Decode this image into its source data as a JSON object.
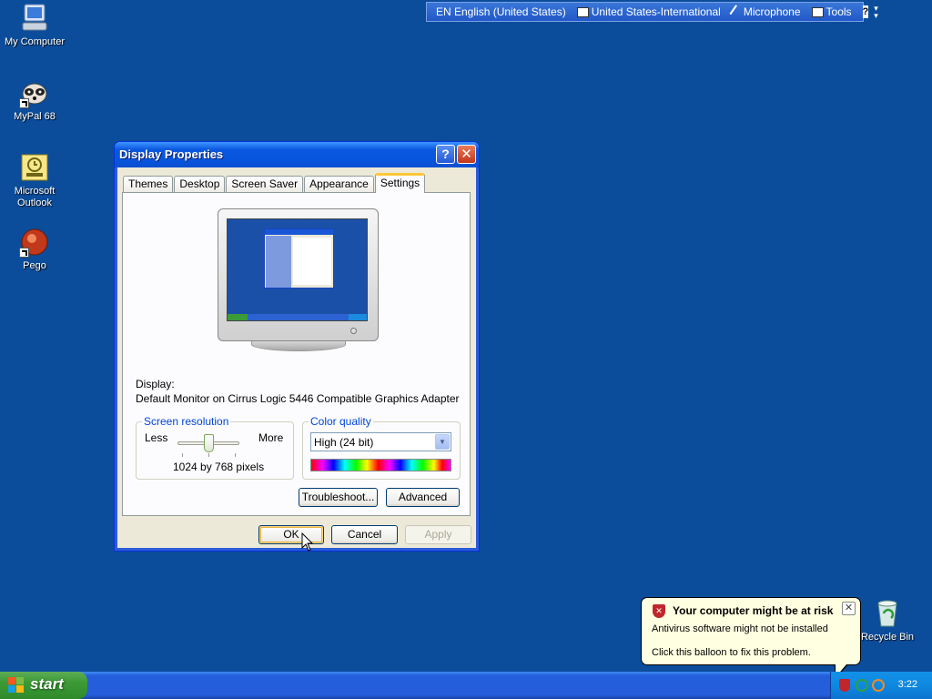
{
  "desktop": {
    "icons": [
      {
        "label": "My Computer"
      },
      {
        "label": "MyPal 68"
      },
      {
        "label": "Microsoft Outlook"
      },
      {
        "label": "Pego"
      }
    ],
    "recycle_bin": {
      "label": "Recycle Bin"
    }
  },
  "language_bar": {
    "language": "EN English (United States)",
    "keyboard": "United States-International",
    "microphone": "Microphone",
    "tools": "Tools",
    "help": "?"
  },
  "window": {
    "title": "Display Properties",
    "help_glyph": "?",
    "close_glyph": "✕",
    "tabs": [
      "Themes",
      "Desktop",
      "Screen Saver",
      "Appearance",
      "Settings"
    ],
    "active_tab": "Settings",
    "display_label": "Display:",
    "display_value": "Default Monitor on Cirrus Logic 5446 Compatible Graphics Adapter",
    "screen_resolution": {
      "legend": "Screen resolution",
      "less": "Less",
      "more": "More",
      "value": "1024 by 768 pixels",
      "slider_position": 0.5
    },
    "color_quality": {
      "legend": "Color quality",
      "selected": "High (24 bit)"
    },
    "buttons": {
      "troubleshoot": "Troubleshoot...",
      "advanced": "Advanced",
      "ok": "OK",
      "cancel": "Cancel",
      "apply": "Apply"
    }
  },
  "balloon": {
    "title": "Your computer might be at risk",
    "line1": "Antivirus software might not be installed",
    "line2": "Click this balloon to fix this problem."
  },
  "taskbar": {
    "start_label": "start",
    "clock": "3:22"
  },
  "colors": {
    "desktop": "#0b4d9b",
    "title_bar": "#0855dd",
    "start_button": "#3c9a36",
    "balloon": "#ffffe1"
  }
}
